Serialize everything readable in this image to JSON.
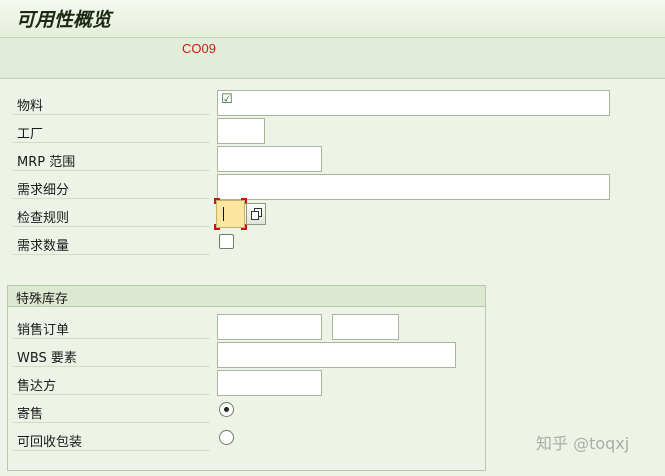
{
  "header": {
    "title": "可用性概览",
    "transaction_code": "CO09"
  },
  "form": {
    "material": {
      "label": "物料",
      "value": "☑"
    },
    "plant": {
      "label": "工厂",
      "value": ""
    },
    "mrp_area": {
      "label": "MRP 范围",
      "value": ""
    },
    "requirements_segment": {
      "label": "需求细分",
      "value": ""
    },
    "checking_rule": {
      "label": "检查规则",
      "value": ""
    },
    "requirements_quantity": {
      "label": "需求数量",
      "checked": false
    }
  },
  "special_stock": {
    "title": "特殊库存",
    "sales_order": {
      "label": "销售订单",
      "value": "",
      "item": ""
    },
    "wbs_element": {
      "label": "WBS 要素",
      "value": ""
    },
    "sold_to_party": {
      "label": "售达方",
      "value": ""
    },
    "consignment": {
      "label": "寄售",
      "selected": true
    },
    "returnable_packaging": {
      "label": "可回收包装",
      "selected": false
    }
  },
  "watermark": "知乎 @toqxj"
}
